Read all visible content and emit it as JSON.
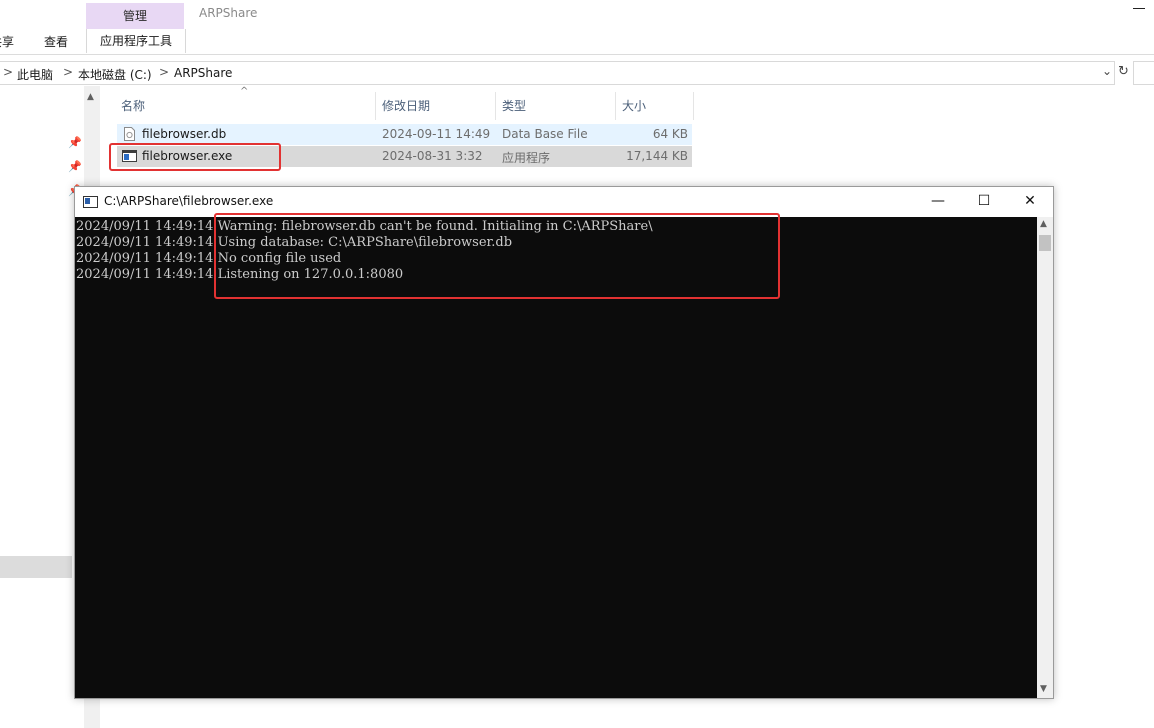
{
  "ribbon": {
    "tab_share": "共享",
    "tab_view": "查看",
    "manage_tab": "管理",
    "app_tools": "应用程序工具",
    "window_title": "ARPShare"
  },
  "address": {
    "crumbs": [
      "此电脑",
      "本地磁盘 (C:)",
      "ARPShare"
    ],
    "separator": ">",
    "dropdown_icon": "chevron-down-icon",
    "refresh_icon": "refresh-icon"
  },
  "columns": {
    "name": "名称",
    "modified": "修改日期",
    "type": "类型",
    "size": "大小"
  },
  "files": [
    {
      "name": "filebrowser.db",
      "modified": "2024-09-11 14:49",
      "type": "Data Base File",
      "size": "64 KB",
      "icon": "database-file-icon"
    },
    {
      "name": "filebrowser.exe",
      "modified": "2024-08-31 3:32",
      "type": "应用程序",
      "size": "17,144 KB",
      "icon": "application-icon"
    }
  ],
  "console": {
    "title": "C:\\ARPShare\\filebrowser.exe",
    "lines": [
      "2024/09/11 14:49:14 Warning: filebrowser.db can't be found. Initialing in C:\\ARPShare\\",
      "2024/09/11 14:49:14 Using database: C:\\ARPShare\\filebrowser.db",
      "2024/09/11 14:49:14 No config file used",
      "2024/09/11 14:49:14 Listening on 127.0.0.1:8080"
    ],
    "minimize": "—",
    "maximize": "☐",
    "close": "✕"
  },
  "colors": {
    "manage_tab_bg": "#e8d8f4",
    "highlight_red": "#e23232",
    "console_bg": "#0c0c0c",
    "console_text": "#cccccc",
    "row_hover": "#e5f3ff",
    "row_selected": "#d9d9d9"
  }
}
